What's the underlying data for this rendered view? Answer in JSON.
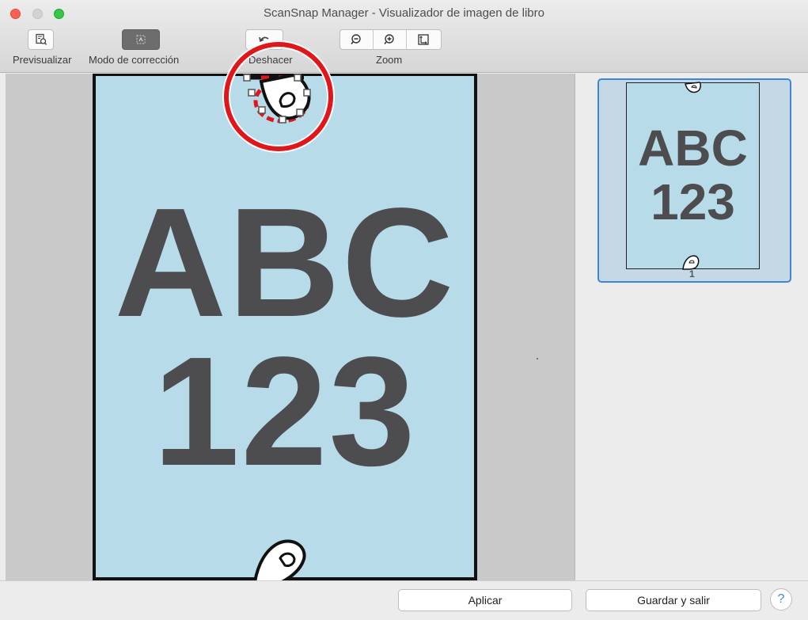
{
  "window": {
    "title": "ScanSnap Manager - Visualizador de imagen de libro"
  },
  "toolbar": {
    "preview_label": "Previsualizar",
    "correction_mode_label": "Modo de corrección",
    "undo_label": "Deshacer",
    "zoom_label": "Zoom"
  },
  "page": {
    "line1": "ABC",
    "line2": "123"
  },
  "thumbnail": {
    "line1": "ABC",
    "line2": "123",
    "page_number": "1"
  },
  "buttons": {
    "apply_label": "Aplicar",
    "save_exit_label": "Guardar y salir",
    "help_label": "?"
  },
  "colors": {
    "page_bg": "#b8dbe9",
    "highlight_circle": "#e0161a",
    "selection_border": "#3d86da"
  }
}
